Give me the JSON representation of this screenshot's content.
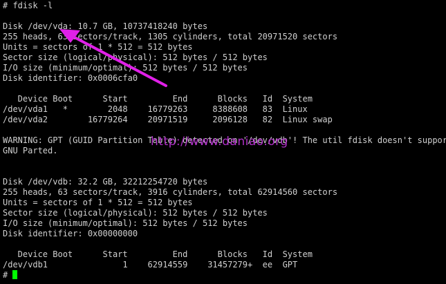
{
  "terminal": {
    "lines": [
      "# fdisk -l",
      "",
      "Disk /dev/vda: 10.7 GB, 10737418240 bytes",
      "255 heads, 63 sectors/track, 1305 cylinders, total 20971520 sectors",
      "Units = sectors of 1 * 512 = 512 bytes",
      "Sector size (logical/physical): 512 bytes / 512 bytes",
      "I/O size (minimum/optimal): 512 bytes / 512 bytes",
      "Disk identifier: 0x0006cfa0",
      "",
      "   Device Boot      Start         End      Blocks   Id  System",
      "/dev/vda1   *        2048    16779263     8388608   83  Linux",
      "/dev/vda2        16779264    20971519     2096128   82  Linux swap",
      "",
      "WARNING: GPT (GUID Partition Table) detected on '/dev/vdb'! The util fdisk doesn't support GPT. Use",
      "GNU Parted.",
      "",
      "",
      "Disk /dev/vdb: 32.2 GB, 32212254720 bytes",
      "255 heads, 63 sectors/track, 3916 cylinders, total 62914560 sectors",
      "Units = sectors of 1 * 512 = 512 bytes",
      "Sector size (logical/physical): 512 bytes / 512 bytes",
      "I/O size (minimum/optimal): 512 bytes / 512 bytes",
      "Disk identifier: 0x00000000",
      "",
      "   Device Boot      Start         End      Blocks   Id  System",
      "/dev/vdb1               1    62914559    31457279+  ee  GPT"
    ],
    "prompt": "# "
  },
  "watermark": "http://www.daniao.org",
  "colors": {
    "background": "#000000",
    "text": "#d0d0d0",
    "cursor": "#00ff00",
    "arrow": "#e020e8",
    "watermark": "#b030c8"
  },
  "icons": {
    "annotation": "arrow-annotation-icon"
  }
}
